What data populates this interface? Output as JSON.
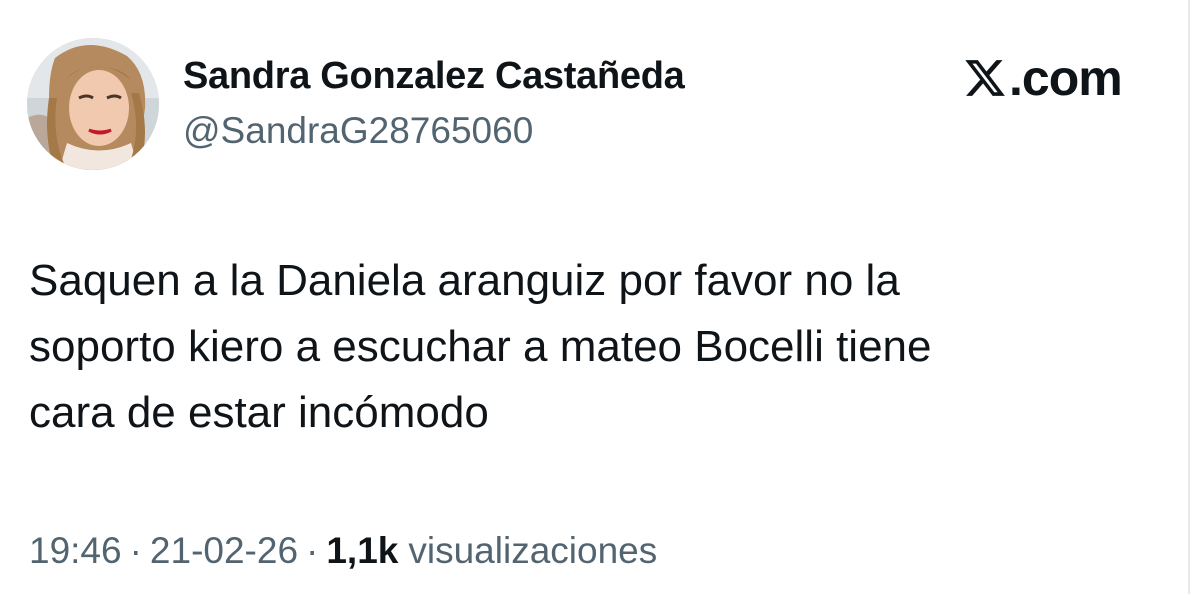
{
  "author": {
    "display_name": "Sandra Gonzalez Castañeda",
    "handle": "@SandraG28765060"
  },
  "brand": {
    "icon": "x-logo-icon",
    "domain": ".com"
  },
  "tweet": {
    "lines": [
      "Saquen a la Daniela aranguiz por favor no la",
      "soporto kiero a escuchar a mateo Bocelli tiene",
      "cara de estar incómodo"
    ]
  },
  "meta": {
    "time": "19:46",
    "separator": "·",
    "date": "21-02-26",
    "views_count": "1,1k",
    "views_label": "visualizaciones"
  },
  "colors": {
    "text_primary": "#0f1419",
    "text_secondary": "#536471",
    "background": "#ffffff"
  }
}
